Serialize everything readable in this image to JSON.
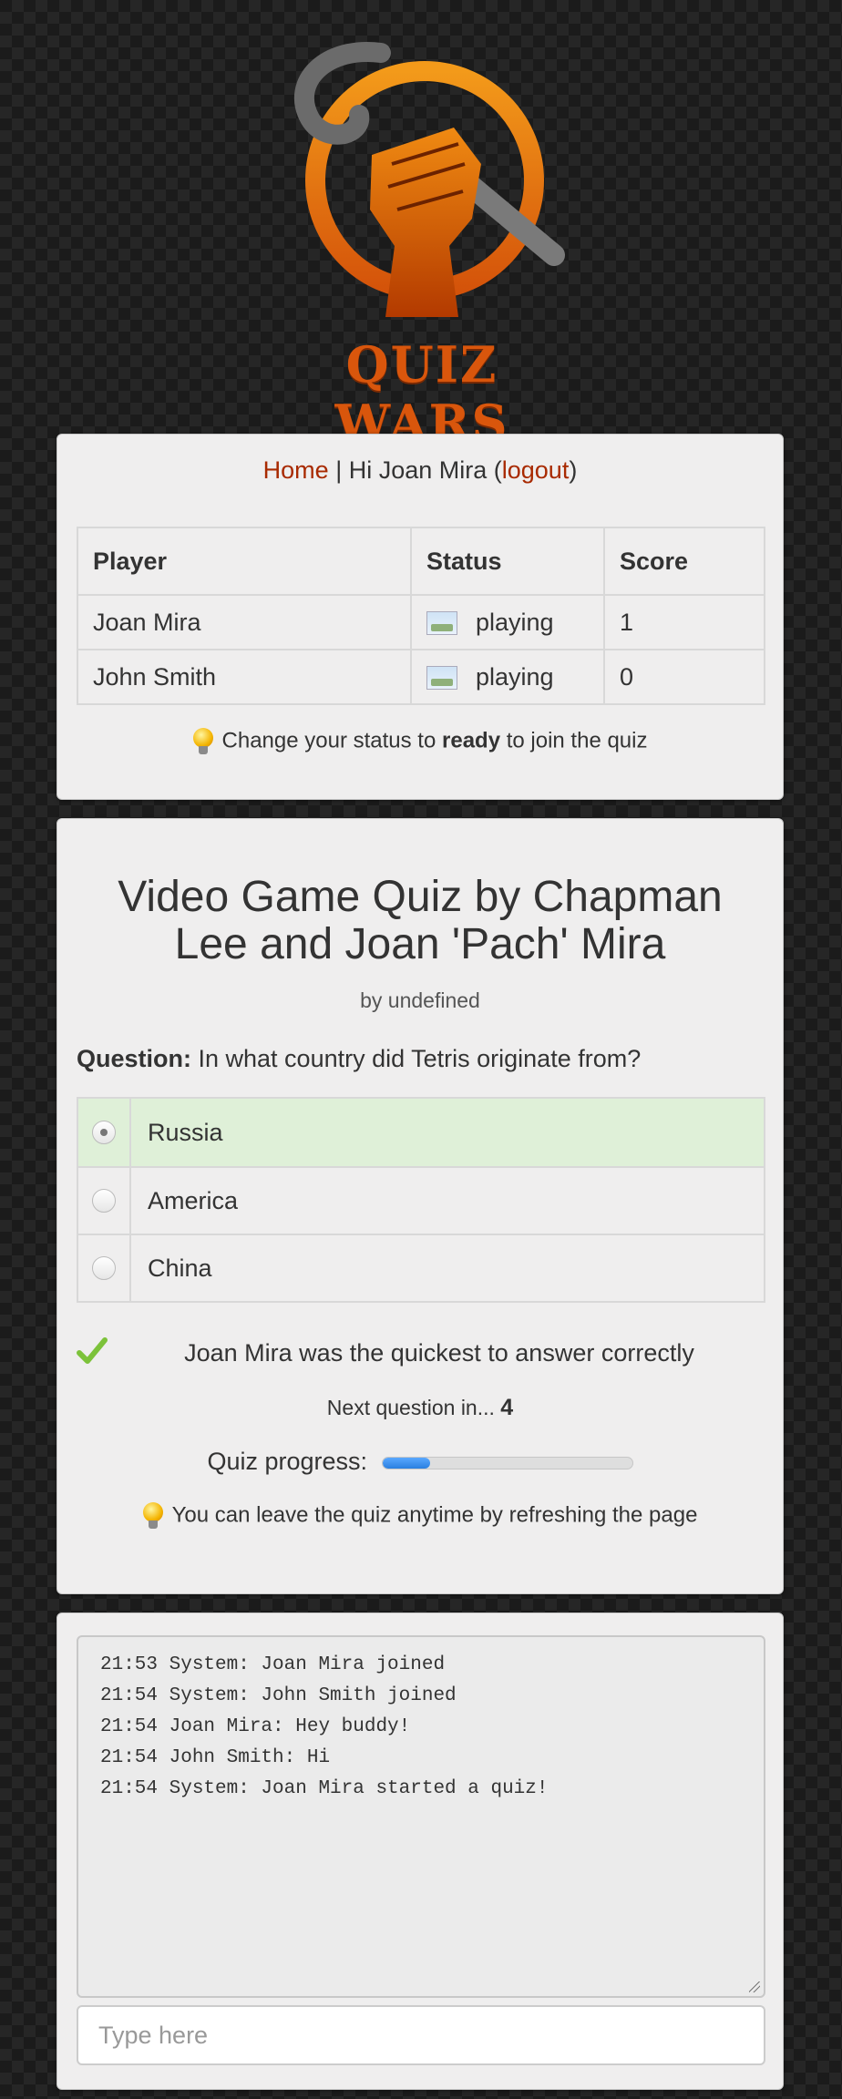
{
  "logo": {
    "text": "QUIZ WARS"
  },
  "nav": {
    "home_label": "Home",
    "separator": " | Hi Joan Mira (",
    "logout_label": "logout",
    "close": ")"
  },
  "players_table": {
    "headers": [
      "Player",
      "Status",
      "Score"
    ],
    "rows": [
      {
        "player": "Joan Mira",
        "status": "playing",
        "score": "1"
      },
      {
        "player": "John Smith",
        "status": "playing",
        "score": "0"
      }
    ]
  },
  "status_hint": {
    "before": "Change your status to ",
    "bold": "ready",
    "after": " to join the quiz"
  },
  "quiz": {
    "title": "Video Game Quiz by Chapman Lee and Joan 'Pach' Mira",
    "by": "by undefined",
    "question_label": "Question:",
    "question_text": " In what country did Tetris originate from?",
    "answers": [
      {
        "label": "Russia",
        "selected": true,
        "correct": true
      },
      {
        "label": "America",
        "selected": false,
        "correct": false
      },
      {
        "label": "China",
        "selected": false,
        "correct": false
      }
    ],
    "winner_text": "Joan Mira was the quickest to answer correctly",
    "next_label": "Next question in... ",
    "next_count": "4",
    "progress_label": "Quiz progress:",
    "progress_fraction": 0.19,
    "leave_hint": "You can leave the quiz anytime by refreshing the page"
  },
  "chat": {
    "lines": [
      "21:53 System: Joan Mira joined",
      "21:54 System: John Smith joined",
      "21:54 Joan Mira: Hey buddy!",
      "21:54 John Smith: Hi",
      "21:54 System: Joan Mira started a quiz!"
    ],
    "input_placeholder": "Type here"
  },
  "colors": {
    "brand_orange": "#d9560c",
    "link": "#a82a00",
    "correct_bg": "#dff0d8",
    "progress": "#2a7fe0"
  }
}
